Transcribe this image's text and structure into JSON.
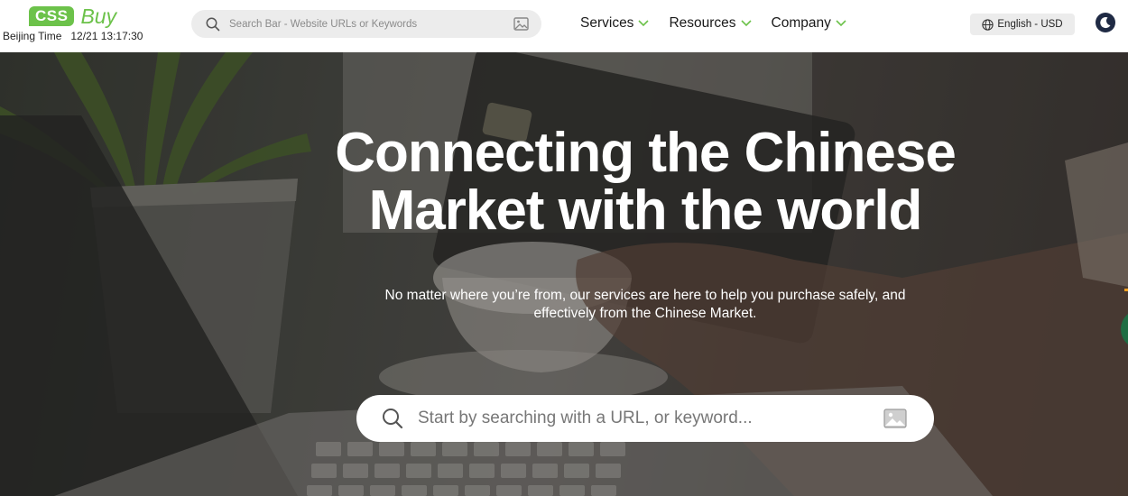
{
  "header": {
    "logo": {
      "badge": "CSS",
      "word": "Buy"
    },
    "clock": {
      "label": "Beijing Time",
      "value": "12/21 13:17:30"
    },
    "search": {
      "placeholder": "Search Bar - Website URLs or Keywords",
      "icon": "search-icon",
      "image_icon": "image-icon"
    },
    "nav": [
      {
        "label": "Services",
        "icon": "chevron-down-icon"
      },
      {
        "label": "Resources",
        "icon": "chevron-down-icon"
      },
      {
        "label": "Company",
        "icon": "chevron-down-icon"
      }
    ],
    "language": {
      "label": "English - USD",
      "icon": "globe-icon"
    },
    "theme_toggle": {
      "icon": "moon-icon"
    }
  },
  "hero": {
    "title_line1": "Connecting the Chinese",
    "title_line2": "Market with the world",
    "subtitle_line1": "No matter where you’re from, our services are here to help you purchase safely, and",
    "subtitle_line2": "effectively from the Chinese Market.",
    "search": {
      "placeholder": "Start by searching with a URL, or keyword...",
      "icon": "search-icon",
      "image_icon": "image-icon"
    }
  },
  "colors": {
    "brand_green": "#6cc24a",
    "nav_chevron": "#6cc24a",
    "search_bg": "#ececec"
  }
}
